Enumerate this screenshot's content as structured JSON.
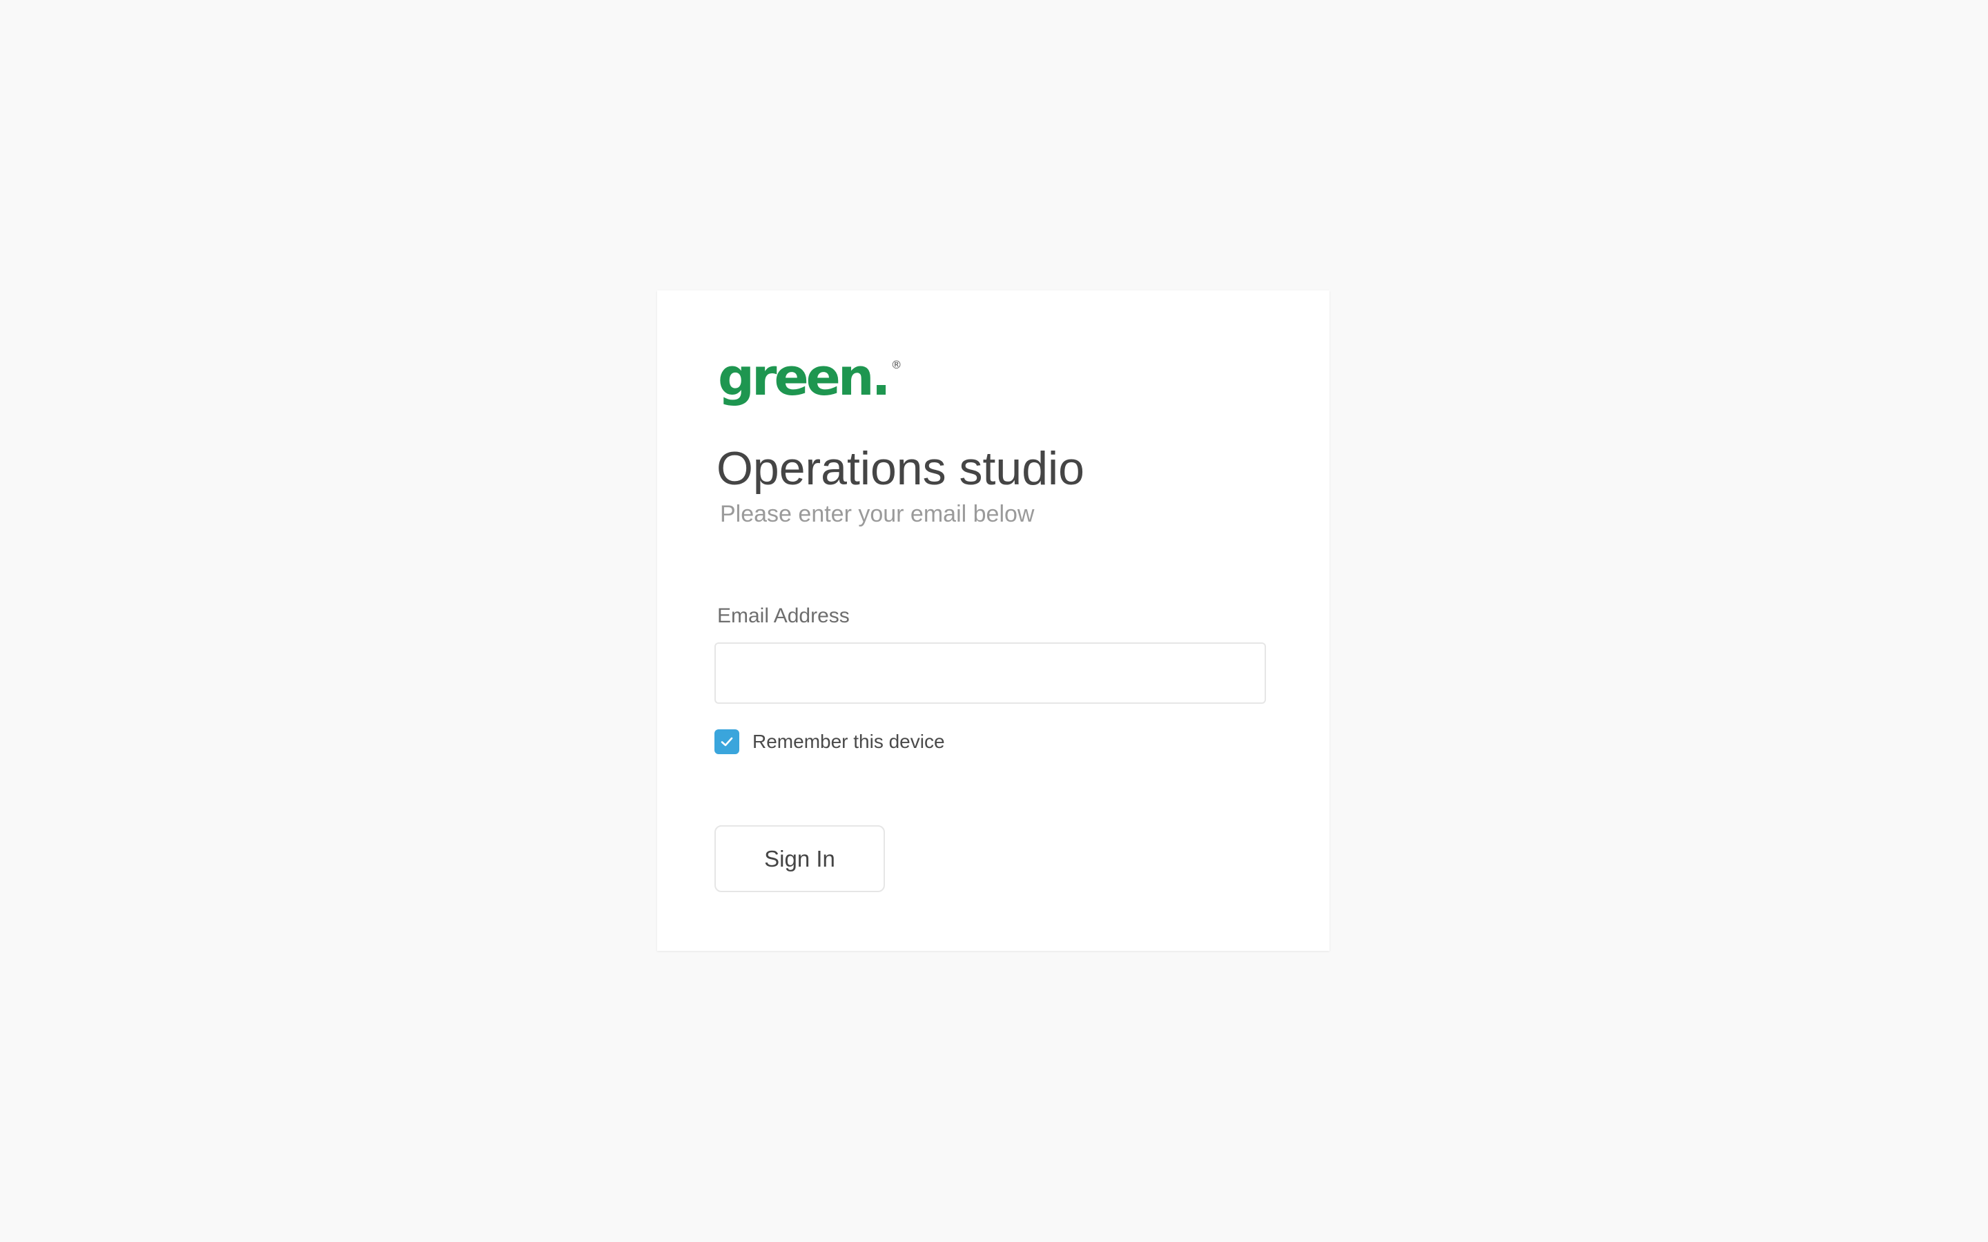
{
  "logo": {
    "text": "green.",
    "mark": "®",
    "color": "#1e9650"
  },
  "page": {
    "title": "Operations studio",
    "subtitle": "Please enter your email below"
  },
  "form": {
    "email": {
      "label": "Email Address",
      "value": "",
      "placeholder": ""
    },
    "remember": {
      "label": "Remember this device",
      "checked": true,
      "icon": "checkmark-icon",
      "color": "#3aa5dc"
    },
    "submit_label": "Sign In"
  }
}
